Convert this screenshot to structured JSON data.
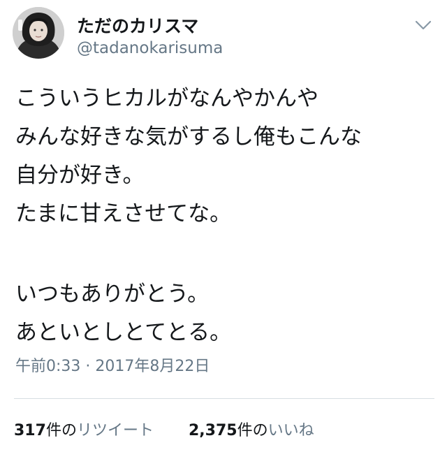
{
  "tweet": {
    "author": {
      "display_name": "ただのカリスマ",
      "handle": "@tadanokarisuma",
      "avatar_icon": "user-avatar"
    },
    "menu_icon": "chevron-down-icon",
    "lines": [
      "こういうヒカルがなんやかんや",
      "みんな好きな気がするし俺もこんな",
      "自分が好き。",
      "たまに甘えさせてな。",
      "",
      "いつもありがとう。",
      "あといとしとてとる。"
    ],
    "timestamp": "午前0:33 · 2017年8月22日",
    "stats": {
      "retweets": {
        "count": "317",
        "unit": "件の",
        "label": "リツイート"
      },
      "likes": {
        "count": "2,375",
        "unit": "件の",
        "label": "いいね"
      }
    }
  },
  "colors": {
    "text": "#14171a",
    "secondary": "#657786",
    "divider": "#d7dde2",
    "chevron": "#8899a6"
  }
}
